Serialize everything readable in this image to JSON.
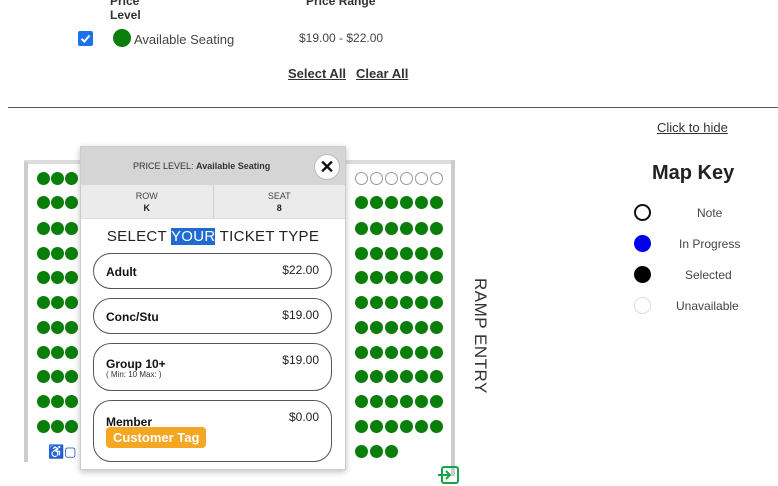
{
  "filters": {
    "col_price_level": "Price Level",
    "col_price_range": "Price Range",
    "rows": [
      {
        "label": "Available Seating",
        "price_range": "$19.00 - $22.00",
        "checked": true,
        "color": "#0a7e0a"
      }
    ],
    "select_all": "Select All",
    "clear_all": "Clear All"
  },
  "map": {
    "ramp_label": "RAMP ENTRY",
    "seat_color": "#0a7e0a",
    "accessible_icons": "♿▢"
  },
  "popup": {
    "price_level_label": "PRICE LEVEL:",
    "price_level_value": "Available Seating",
    "close_label": "✕",
    "row_label": "ROW",
    "row_value": "K",
    "seat_label": "SEAT",
    "seat_value": "8",
    "title_before": "SELECT ",
    "title_highlight": "YOUR",
    "title_after": " TICKET TYPE",
    "ticket_types": [
      {
        "name": "Adult",
        "price": "$22.00"
      },
      {
        "name": "Conc/Stu",
        "price": "$19.00"
      },
      {
        "name": "Group 10+",
        "price": "$19.00",
        "sub": "( Min: 10 Max: )"
      },
      {
        "name": "Member",
        "price": "$0.00",
        "tag": "Customer Tag",
        "tag_color": "#f5a623"
      }
    ]
  },
  "map_key": {
    "hide_link": "Click to hide",
    "title": "Map Key",
    "items": [
      {
        "label": "Note",
        "style": "outline-black"
      },
      {
        "label": "In Progress",
        "color": "#0000ee"
      },
      {
        "label": "Selected",
        "color": "#000000"
      },
      {
        "label": "Unavailable",
        "style": "outline-light"
      }
    ]
  }
}
